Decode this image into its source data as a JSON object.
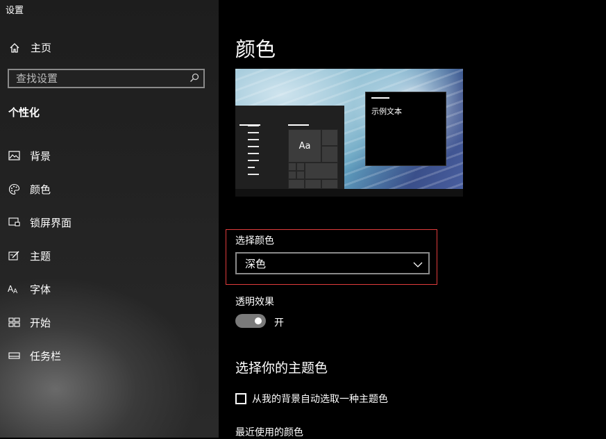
{
  "app": {
    "title": "设置"
  },
  "sidebar": {
    "home_label": "主页",
    "search_placeholder": "查找设置",
    "section_title": "个性化",
    "items": [
      {
        "label": "背景",
        "icon": "picture-icon"
      },
      {
        "label": "颜色",
        "icon": "palette-icon"
      },
      {
        "label": "锁屏界面",
        "icon": "lock-screen-icon"
      },
      {
        "label": "主题",
        "icon": "theme-icon"
      },
      {
        "label": "字体",
        "icon": "font-icon"
      },
      {
        "label": "开始",
        "icon": "start-icon"
      },
      {
        "label": "任务栏",
        "icon": "taskbar-icon"
      }
    ]
  },
  "main": {
    "title": "颜色",
    "preview": {
      "tile_label": "Aa",
      "sample_text": "示例文本"
    },
    "choose_color": {
      "label": "选择颜色",
      "value": "深色"
    },
    "transparency": {
      "label": "透明效果",
      "state_text": "开",
      "on": true
    },
    "accent": {
      "title": "选择你的主题色",
      "auto_label": "从我的背景自动选取一种主题色",
      "auto_checked": false,
      "recent_label": "最近使用的颜色"
    }
  },
  "colors": {
    "highlight_border": "#e03c3c",
    "background": "#000000",
    "sidebar": "#222222"
  }
}
